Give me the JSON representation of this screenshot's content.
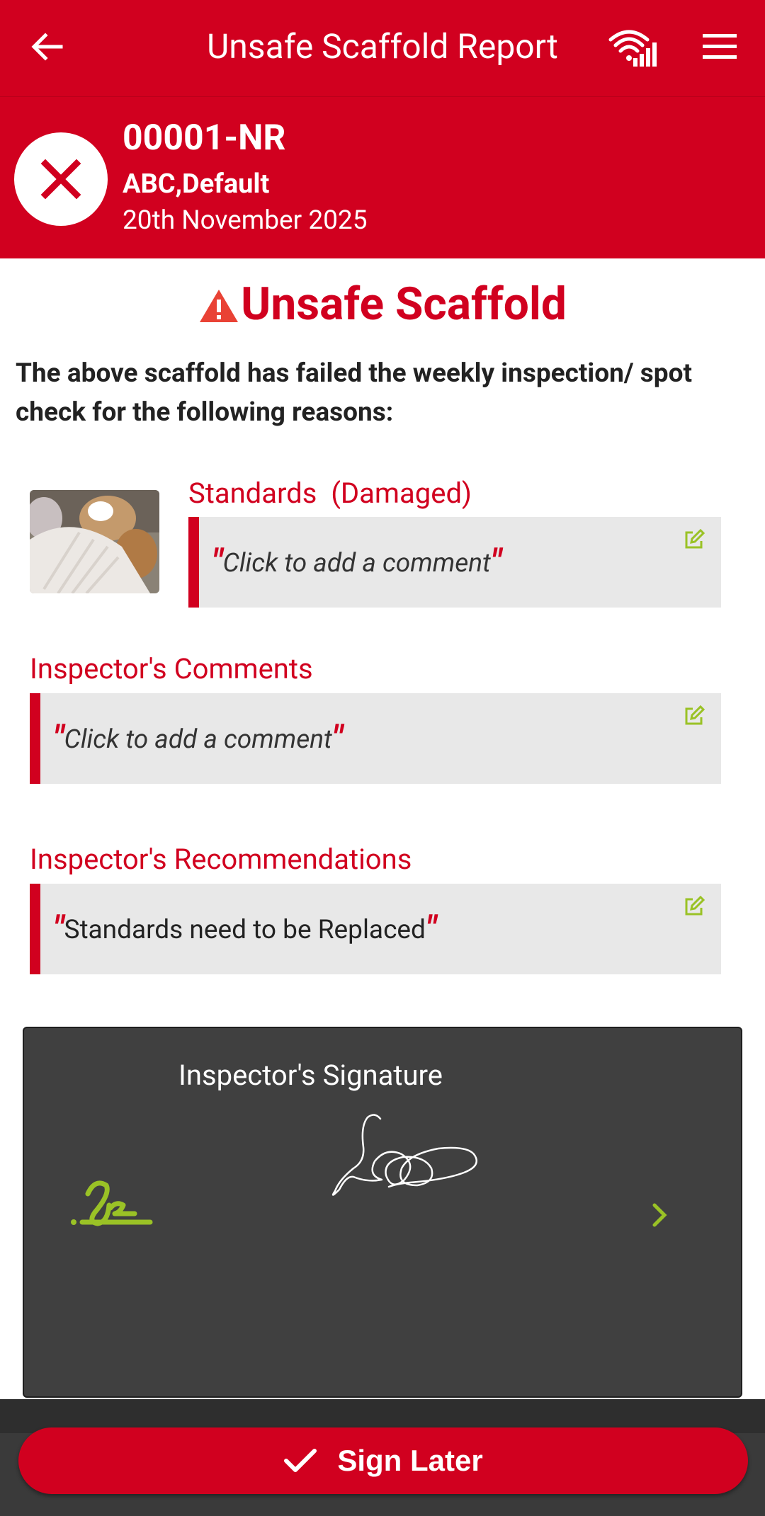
{
  "appbar": {
    "title": "Unsafe Scaffold Report",
    "icons": [
      "arrow-left-icon",
      "wifi-signal-icon",
      "menu-icon"
    ]
  },
  "header": {
    "reference": "00001-NR",
    "company": "ABC,Default",
    "date": "20th November 2025",
    "status_icon": "close-x-icon"
  },
  "warning": {
    "title": "Unsafe Scaffold",
    "icon": "warning-triangle-icon",
    "intro": "The above scaffold has failed the weekly inspection/ spot check for the following reasons:"
  },
  "reason": {
    "label": "Standards  (Damaged)",
    "comment": "Click to add a comment"
  },
  "inspector_comments": {
    "label": "Inspector's Comments",
    "comment": "Click to add a comment"
  },
  "inspector_recommendations": {
    "label": "Inspector's Recommendations",
    "comment": "Standards need to be Replaced"
  },
  "signature": {
    "title": "Inspector's Signature"
  },
  "footer": {
    "sign_later_label": "Sign Later"
  },
  "colors": {
    "brand_red": "#d1001f",
    "accent_green": "#9ac226",
    "panel_dark": "#404040"
  }
}
